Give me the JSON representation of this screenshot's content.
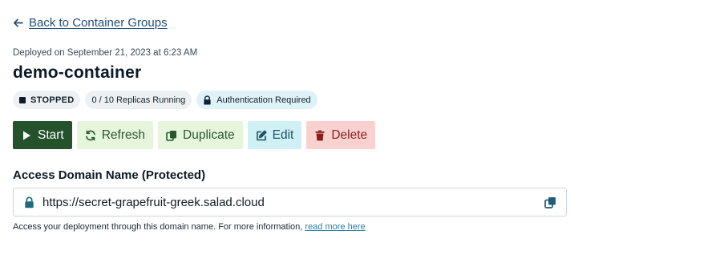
{
  "nav": {
    "back_label": "Back to Container Groups"
  },
  "container": {
    "deployed_text": "Deployed on September 21, 2023 at 6:23 AM",
    "name": "demo-container"
  },
  "badges": {
    "status": "STOPPED",
    "replicas": "0 / 10 Replicas Running",
    "auth": "Authentication Required"
  },
  "actions": {
    "start": "Start",
    "refresh": "Refresh",
    "duplicate": "Duplicate",
    "edit": "Edit",
    "delete": "Delete"
  },
  "access_domain": {
    "label": "Access Domain Name (Protected)",
    "value": "https://secret-grapefruit-greek.salad.cloud",
    "help_text": "Access your deployment through this domain name. For more information, ",
    "help_link": "read more here"
  },
  "icons": {
    "back": "arrow-left-icon",
    "stopped": "stop-square-icon",
    "auth": "lock-icon",
    "start": "play-icon",
    "refresh": "refresh-icon",
    "duplicate": "duplicate-icon",
    "edit": "edit-icon",
    "delete": "trash-icon",
    "domain_lock": "lock-icon",
    "copy": "copy-icon"
  },
  "colors": {
    "start_bg": "#24532b",
    "secondary_green_bg": "#e6f6dc",
    "edit_bg": "#cff0f4",
    "delete_bg": "#f9d2d0",
    "link": "#1f4d7a"
  }
}
